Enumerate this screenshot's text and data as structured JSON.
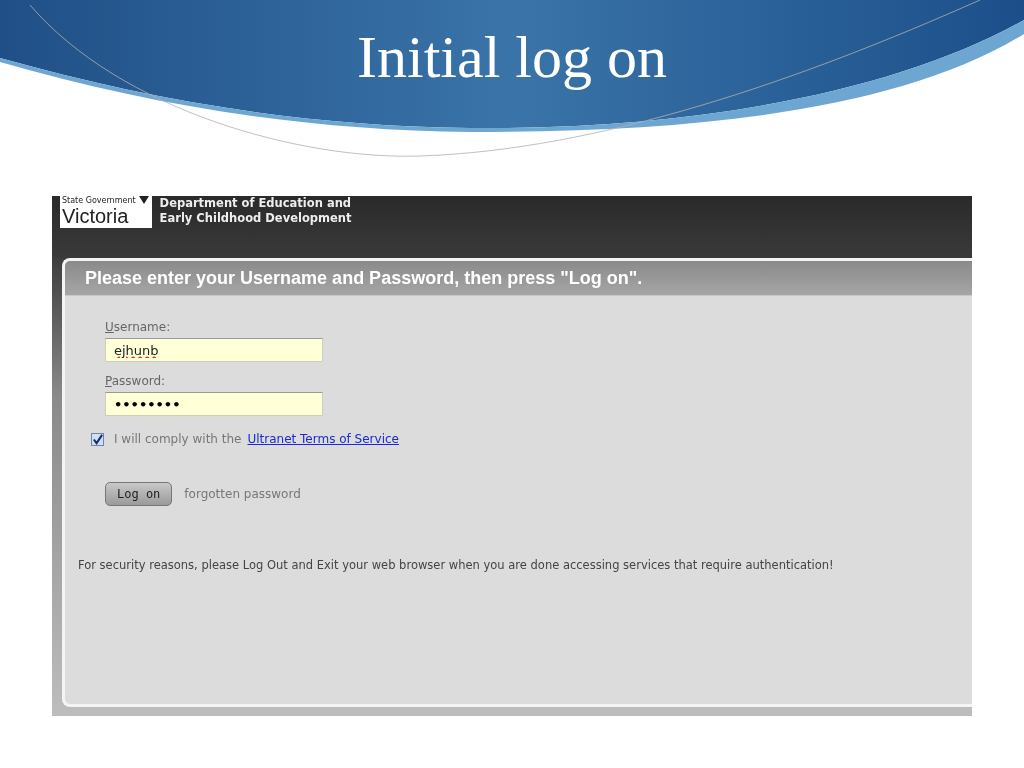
{
  "slide": {
    "title": "Initial log on"
  },
  "site_header": {
    "logo": {
      "caption": "State Government",
      "name": "Victoria"
    },
    "department": [
      "Department of Education and",
      "Early Childhood Development"
    ]
  },
  "login": {
    "heading": "Please enter your Username and Password, then press \"Log on\".",
    "fields": [
      {
        "label": "Username:",
        "value": "ejhunb",
        "kind": "text"
      },
      {
        "label": "Password:",
        "value": "••••••••",
        "kind": "password"
      }
    ],
    "terms": {
      "checked": true,
      "text": "I will comply with the",
      "link": "Ultranet Terms of Service"
    },
    "button": "Log on",
    "forgot_link": "forgotten password",
    "notice": "For security reasons, please Log Out and Exit your web browser when you are done accessing services that require authentication!"
  }
}
